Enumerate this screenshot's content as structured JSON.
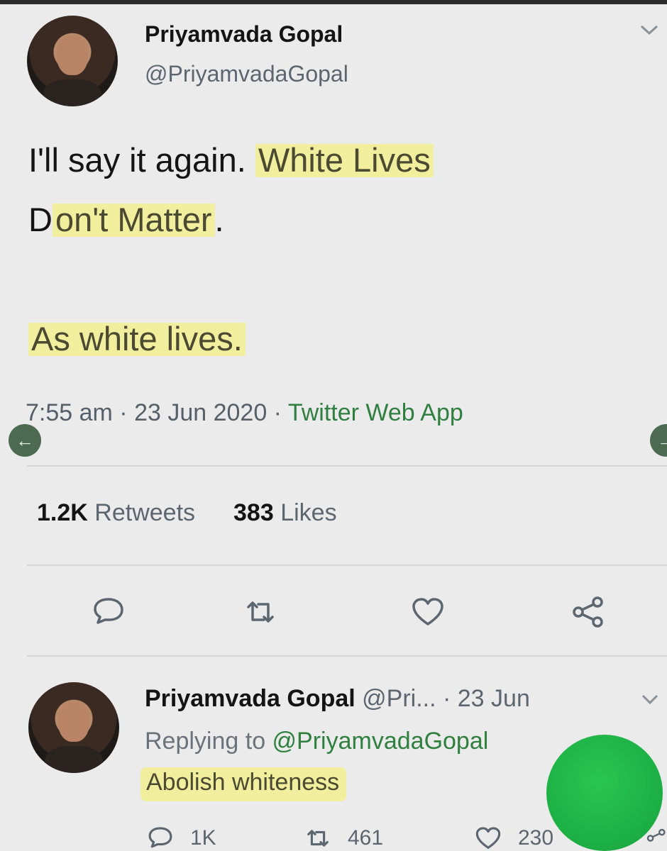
{
  "tweet": {
    "author_name": "Priyamvada Gopal",
    "author_handle": "@PriyamvadaGopal",
    "text_line1_plain": "I'll say it again. ",
    "text_line1_highlight": "White Lives",
    "text_line2_lead": "D",
    "text_line2_highlight": "on't Matter",
    "text_line2_tail": ".",
    "text_line3_highlight": "As white lives.",
    "timestamp": "7:55 am · 23 Jun 2020 · ",
    "source": "Twitter Web App",
    "retweets_count": "1.2K",
    "retweets_label": "Retweets",
    "likes_count": "383",
    "likes_label": "Likes"
  },
  "reply": {
    "author_name": "Priyamvada Gopal",
    "author_handle": "@Pri...",
    "date": " · 23 Jun",
    "replying_label": "Replying to ",
    "replying_handle": "@PriyamvadaGopal",
    "text": "Abolish whiteness",
    "reply_count": "1K",
    "retweet_count": "461",
    "like_count": "230"
  },
  "icons": [
    "chevron-down-icon",
    "arrow-left-icon",
    "reply-icon",
    "retweet-icon",
    "heart-icon",
    "share-icon"
  ],
  "colors": {
    "highlight": "#f1ee9e",
    "link_green": "#2f7f3f",
    "fab_green": "#1cae43",
    "nav_button": "#4c6a4f"
  }
}
